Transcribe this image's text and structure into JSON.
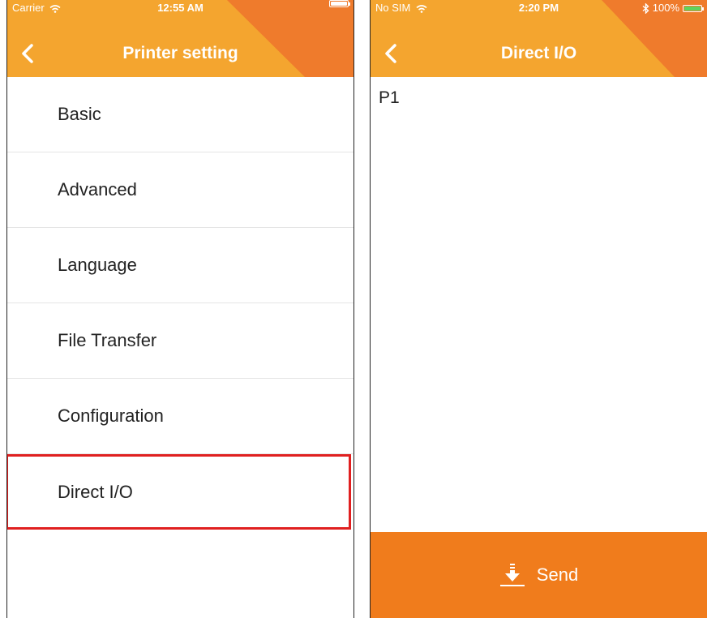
{
  "left_screen": {
    "status": {
      "carrier": "Carrier",
      "time": "12:55 AM"
    },
    "nav": {
      "title": "Printer setting"
    },
    "items": [
      {
        "label": "Basic"
      },
      {
        "label": "Advanced"
      },
      {
        "label": "Language"
      },
      {
        "label": "File Transfer"
      },
      {
        "label": "Configuration"
      },
      {
        "label": "Direct I/O",
        "highlighted": true
      }
    ]
  },
  "right_screen": {
    "status": {
      "carrier": "No SIM",
      "time": "2:20 PM",
      "battery": "100%"
    },
    "nav": {
      "title": "Direct I/O"
    },
    "editor": {
      "value": "P1"
    },
    "send_button": {
      "label": "Send",
      "icon": "download-icon"
    }
  },
  "colors": {
    "header_light": "#f4a52f",
    "header_dark": "#ef7b2c",
    "send": "#f07c1c",
    "highlight": "#e02020"
  }
}
